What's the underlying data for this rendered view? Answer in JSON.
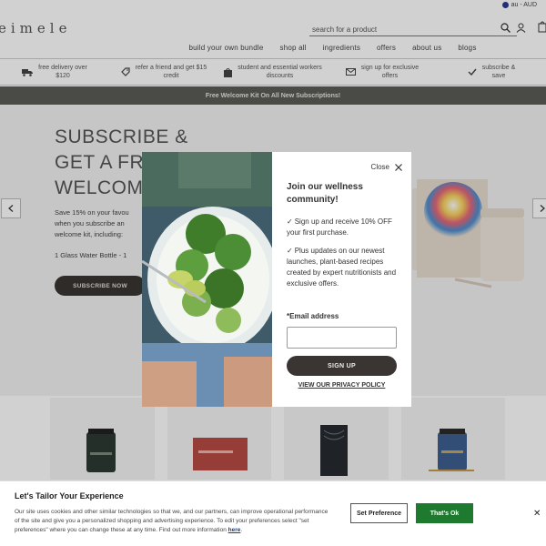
{
  "header": {
    "region": "au - AUD",
    "logo": "eimele",
    "search_placeholder": "search for a product"
  },
  "nav": [
    {
      "label": "build your own bundle"
    },
    {
      "label": "shop all"
    },
    {
      "label": "ingredients"
    },
    {
      "label": "offers"
    },
    {
      "label": "about us"
    },
    {
      "label": "blogs"
    }
  ],
  "perks": [
    {
      "line1": "free delivery over",
      "line2": "$120",
      "icon": "truck-icon"
    },
    {
      "line1": "refer a friend and get $15",
      "line2": "credit",
      "icon": "tag-icon"
    },
    {
      "line1": "student and essential workers",
      "line2": "discounts",
      "icon": "bag-icon"
    },
    {
      "line1": "sign up for exclusive",
      "line2": "offers",
      "icon": "mail-icon"
    },
    {
      "line1": "subscribe &",
      "line2": "save",
      "icon": "check-icon"
    }
  ],
  "promo": "Free Welcome Kit On All New Subscriptions!",
  "hero": {
    "title_lines": [
      "SUBSCRIBE &",
      "GET A FR",
      "WELCOM"
    ],
    "copy_lines": [
      "Save 15% on your favou",
      "when you subscribe an",
      "welcome kit, including:"
    ],
    "list": "1 Glass Water Bottle - 1",
    "cta": "SUBSCRIBE NOW"
  },
  "modal": {
    "close_label": "Close",
    "heading": "Join our wellness community!",
    "bullet1": "Sign up and receive 10% OFF your first purchase.",
    "bullet2": "Plus updates on our newest launches, plant-based recipes created by expert nutritionists and exclusive offers.",
    "email_label": "*Email address",
    "email_value": "",
    "signup_label": "SIGN UP",
    "privacy_label": "VIEW OUR PRIVACY POLICY"
  },
  "cookie": {
    "title": "Let's Tailor Your Experience",
    "text": "Our site uses cookies and other similar technologies so that we, and our partners, can improve operational performance of the site and give you a personalized shopping and advertising experience. To edit your preferences select \"set preferences\" where you can change these at any time. Find out more information ",
    "link": "here",
    "pref_label": "Set Preference",
    "ok_label": "That's Ok"
  },
  "colors": {
    "dark_button": "#3a3532",
    "promo_bar": "#5b5b56",
    "ok_green": "#1d7a2e"
  }
}
